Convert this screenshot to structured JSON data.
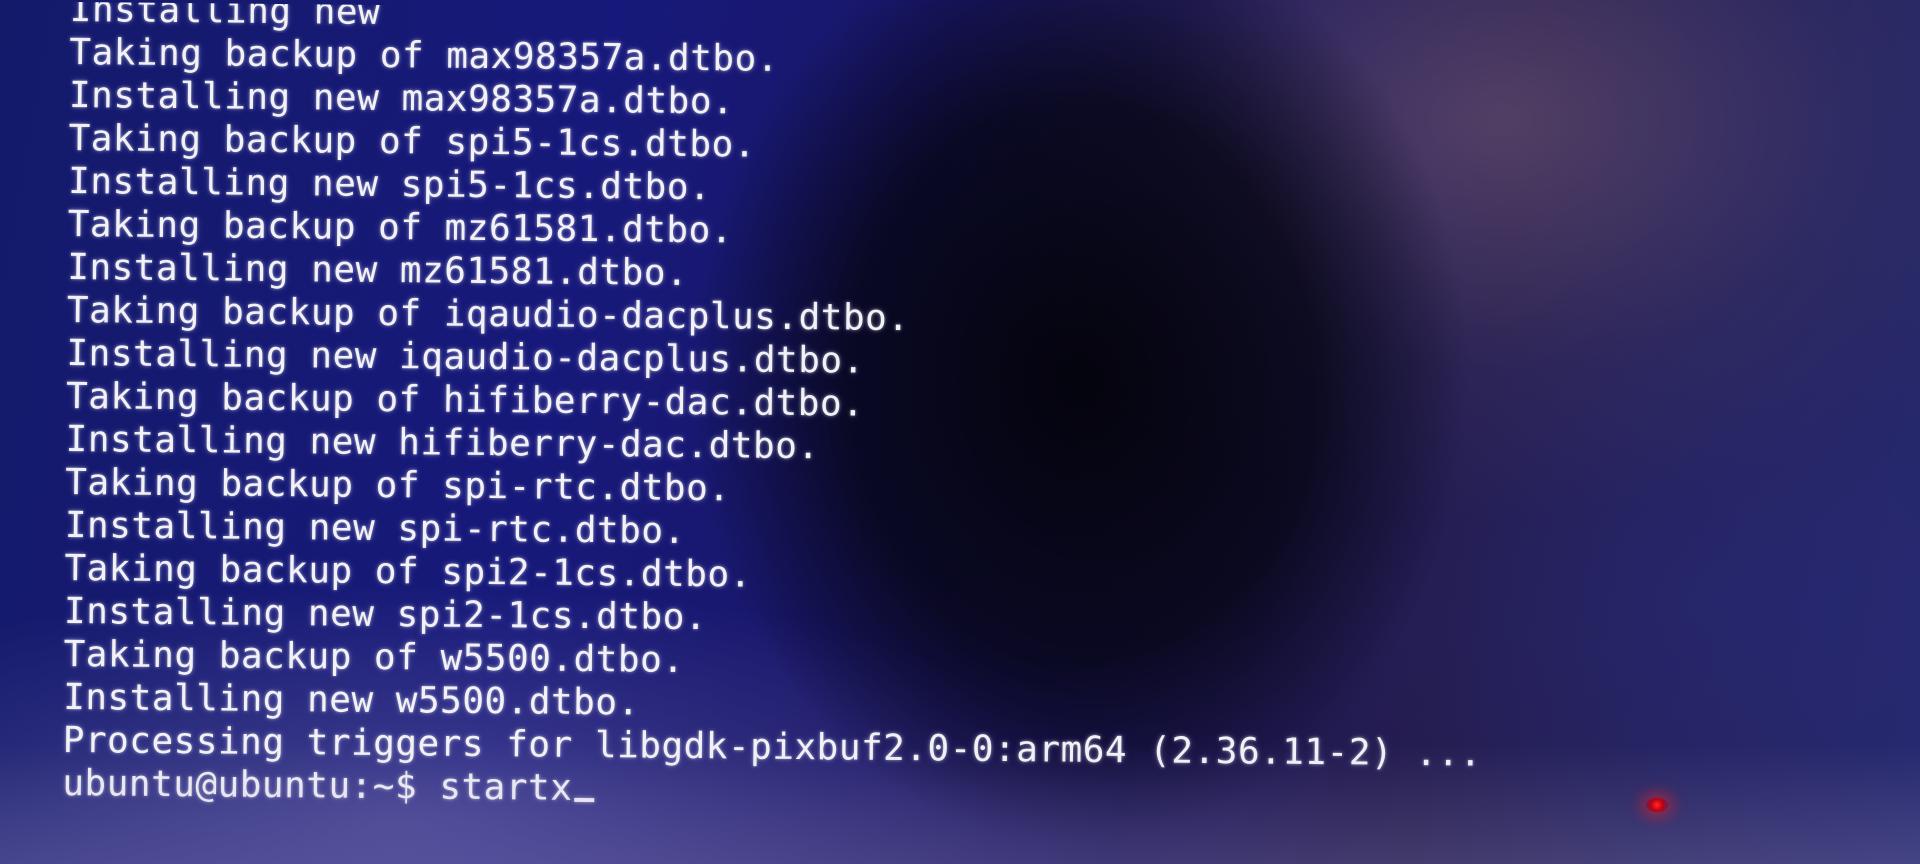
{
  "terminal": {
    "lines": [
      "Installing new",
      "Taking backup of max98357a.dtbo.",
      "Installing new max98357a.dtbo.",
      "Taking backup of spi5-1cs.dtbo.",
      "Installing new spi5-1cs.dtbo.",
      "Taking backup of mz61581.dtbo.",
      "Installing new mz61581.dtbo.",
      "Taking backup of iqaudio-dacplus.dtbo.",
      "Installing new iqaudio-dacplus.dtbo.",
      "Taking backup of hifiberry-dac.dtbo.",
      "Installing new hifiberry-dac.dtbo.",
      "Taking backup of spi-rtc.dtbo.",
      "Installing new spi-rtc.dtbo.",
      "Taking backup of spi2-1cs.dtbo.",
      "Installing new spi2-1cs.dtbo.",
      "Taking backup of w5500.dtbo.",
      "Installing new w5500.dtbo.",
      "Processing triggers for libgdk-pixbuf2.0-0:arm64 (2.36.11-2) ..."
    ],
    "prompt": "ubuntu@ubuntu:~$ ",
    "command": "startx"
  },
  "colors": {
    "text": "#f2f2f6",
    "background": "#17197a",
    "led": "#ff2a2a"
  }
}
